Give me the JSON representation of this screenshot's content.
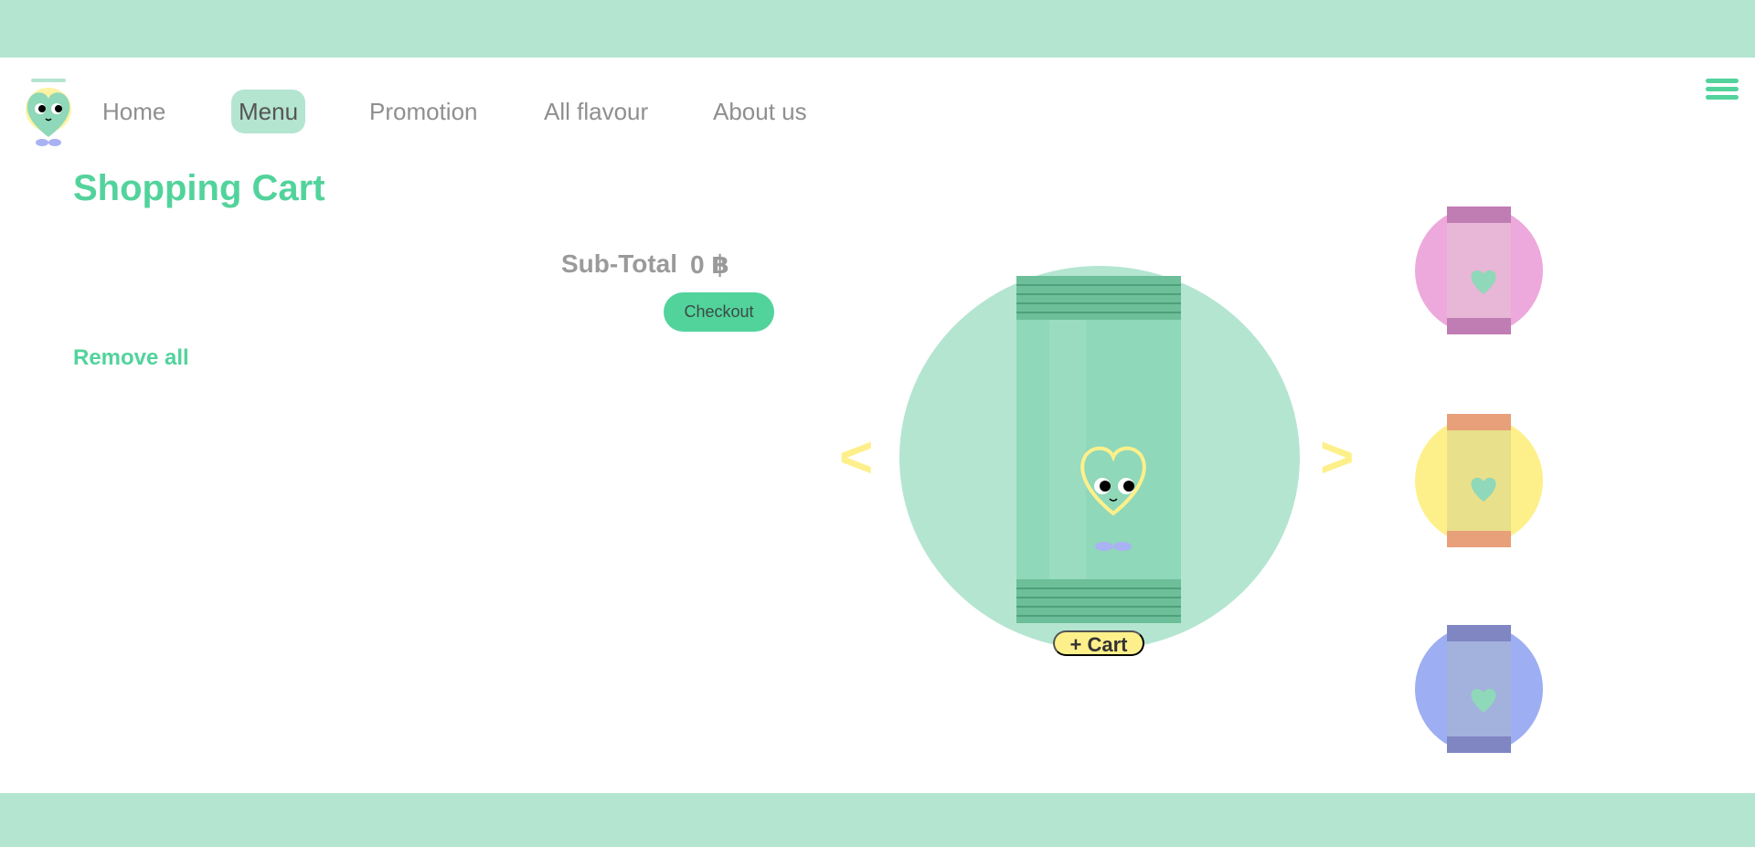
{
  "nav": {
    "items": [
      {
        "label": "Home"
      },
      {
        "label": "Menu"
      },
      {
        "label": "Promotion"
      },
      {
        "label": "All flavour"
      },
      {
        "label": "About us"
      }
    ],
    "active": "Menu"
  },
  "cart": {
    "title": "Shopping Cart",
    "subtotal_label": "Sub-Total",
    "subtotal_value": "0 ฿",
    "checkout_label": "Checkout",
    "remove_all_label": "Remove all"
  },
  "carousel": {
    "prev_label": "<",
    "next_label": ">",
    "add_to_cart_label": "+ Cart",
    "featured_color": "#8fd8b9",
    "thumbnails": [
      {
        "name": "pink-flavour",
        "circle": "#eda9dc",
        "pack": "#d89dc8",
        "edge": "#c07db4"
      },
      {
        "name": "yellow-flavour",
        "circle": "#fdf08b",
        "pack": "#e8e08a",
        "edge": "#e8a07a"
      },
      {
        "name": "blue-flavour",
        "circle": "#9daff2",
        "pack": "#a3b1dd",
        "edge": "#7f86c2"
      }
    ]
  },
  "colors": {
    "accent": "#52d39c",
    "mint": "#b4e5d1",
    "yellow": "#fdf08b"
  },
  "icons": [
    "logo-mascot-icon",
    "hamburger-menu-icon"
  ]
}
